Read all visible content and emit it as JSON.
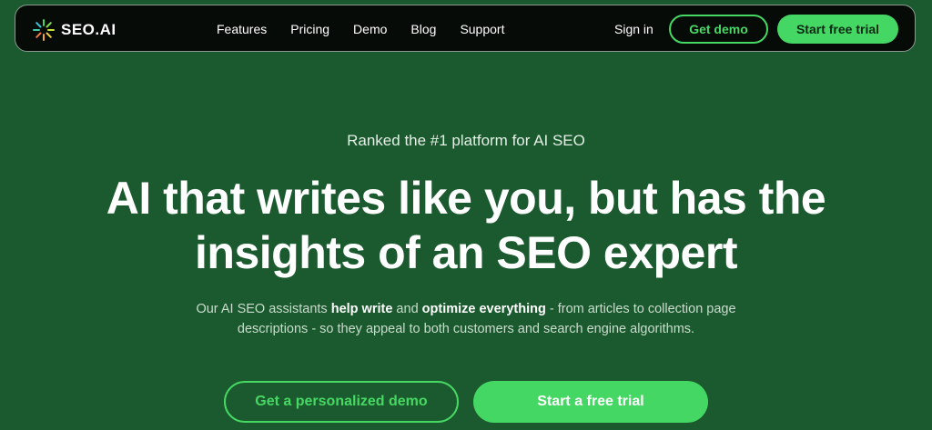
{
  "nav": {
    "logo_text": "SEO.AI",
    "links": [
      "Features",
      "Pricing",
      "Demo",
      "Blog",
      "Support"
    ],
    "signin": "Sign in",
    "get_demo": "Get demo",
    "start_trial": "Start free trial"
  },
  "hero": {
    "eyebrow": "Ranked the #1 platform for AI SEO",
    "headline_line1": "AI that writes like you, but has the",
    "headline_line2": "insights of an SEO expert",
    "sub_part1": "Our AI SEO assistants ",
    "sub_bold1": "help write",
    "sub_part2": " and ",
    "sub_bold2": "optimize everything",
    "sub_part3": " - from articles to collection page",
    "sub_line2": "descriptions - so they appeal to both customers and search engine algorithms.",
    "cta_demo": "Get a personalized demo",
    "cta_trial": "Start a free trial"
  },
  "colors": {
    "background": "#1b5a2e",
    "navbar": "#070b08",
    "accent": "#45d764"
  },
  "icons": {
    "logo": "sunburst-logo-icon"
  }
}
